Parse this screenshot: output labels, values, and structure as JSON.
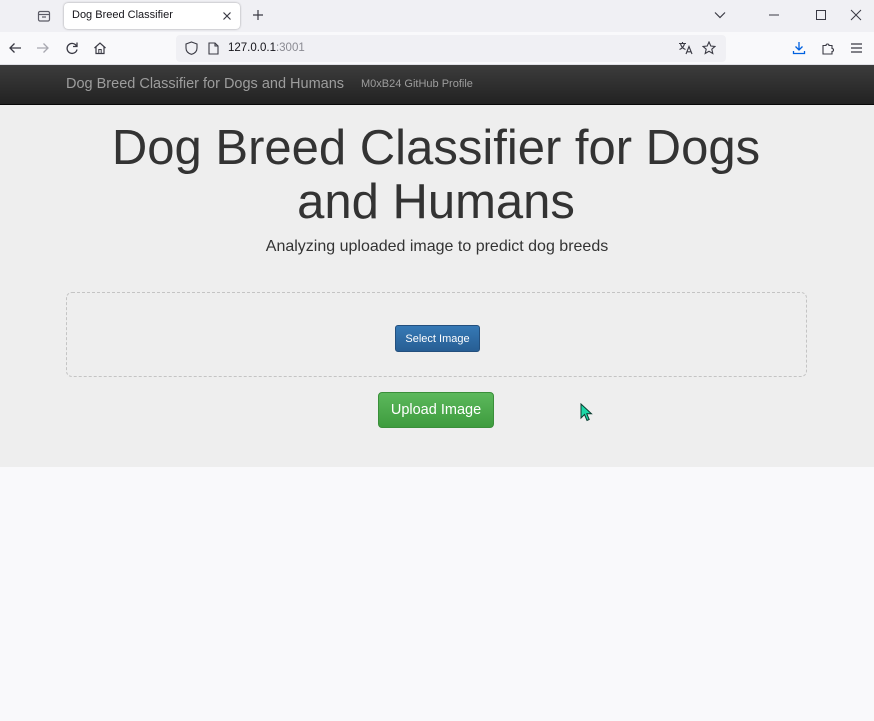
{
  "browser": {
    "tab_title": "Dog Breed Classifier",
    "url_host": "127.0.0.1",
    "url_port": ":3001",
    "icons": {
      "tab_list": "tab-list-icon",
      "close_tab": "close-icon",
      "new_tab": "plus-icon",
      "list_all_tabs": "chevron-down-icon",
      "minimize": "minimize-icon",
      "maximize": "maximize-icon",
      "close_window": "close-icon",
      "back": "back-arrow-icon",
      "forward": "forward-arrow-icon",
      "reload": "reload-icon",
      "home": "home-icon",
      "tracking_protection": "shield-icon",
      "page_info": "page-icon",
      "translate": "translate-icon",
      "bookmark": "star-icon",
      "downloads": "download-icon",
      "extensions": "puzzle-icon",
      "menu": "hamburger-menu-icon"
    }
  },
  "site_nav": {
    "brand": "Dog Breed Classifier for Dogs and Humans",
    "link": "M0xB24 GitHub Profile"
  },
  "hero": {
    "title": "Dog Breed Classifier for Dogs and Humans",
    "subtitle": "Analyzing uploaded image to predict dog breeds"
  },
  "form": {
    "select_button": "Select Image",
    "upload_button": "Upload Image"
  },
  "colors": {
    "navbar": "#222222",
    "jumbotron": "#eeeeee",
    "primary_button": "#2e6da4",
    "success_button": "#4cae4c",
    "cursor": "#1dd7a7"
  }
}
